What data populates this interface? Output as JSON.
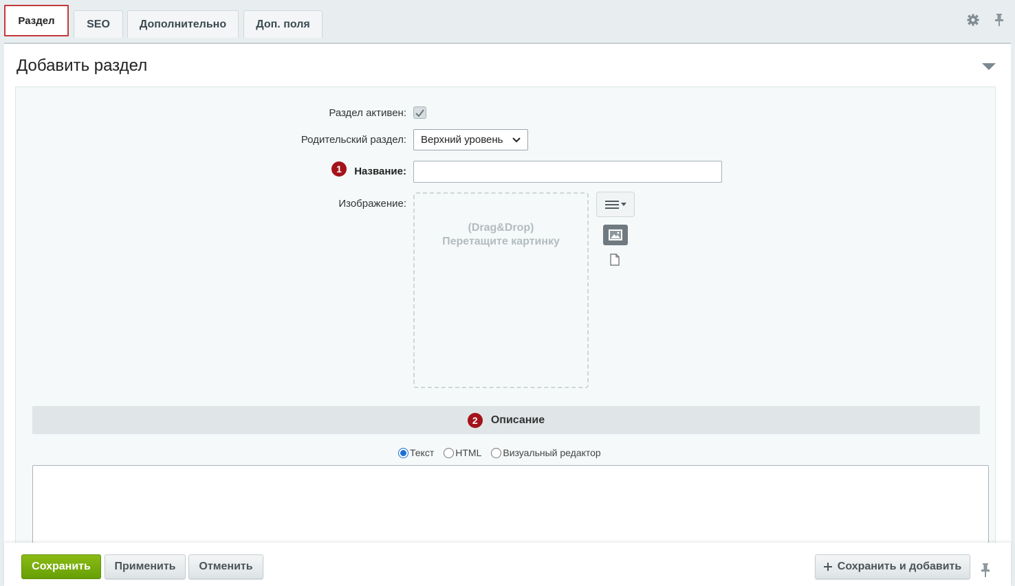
{
  "tabs": [
    {
      "label": "Раздел"
    },
    {
      "label": "SEO"
    },
    {
      "label": "Дополнительно"
    },
    {
      "label": "Доп. поля"
    }
  ],
  "panel": {
    "title": "Добавить раздел"
  },
  "form": {
    "active_label": "Раздел активен:",
    "active_checked": true,
    "parent_label": "Родительский раздел:",
    "parent_value": "Верхний уровень",
    "name_badge": "1",
    "name_label": "Название:",
    "name_value": "",
    "image_label": "Изображение:",
    "dropzone_line1": "(Drag&Drop)",
    "dropzone_line2": "Перетащите картинку"
  },
  "description": {
    "badge": "2",
    "title": "Описание",
    "modes": [
      "Текст",
      "HTML",
      "Визуальный редактор"
    ],
    "selected_mode": "Текст",
    "value": ""
  },
  "footer": {
    "save": "Сохранить",
    "apply": "Применить",
    "cancel": "Отменить",
    "save_add": "Сохранить и добавить"
  },
  "colors": {
    "active_tab_border": "#c4373a",
    "required_badge": "#a4131a",
    "save_button": "#77aa0a"
  }
}
